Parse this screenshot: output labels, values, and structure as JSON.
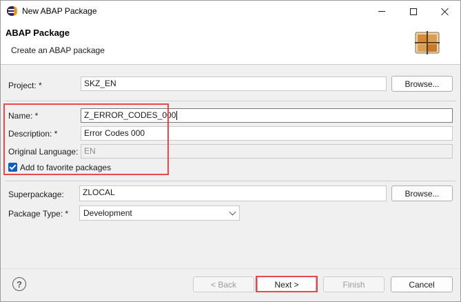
{
  "window": {
    "title": "New ABAP Package"
  },
  "header": {
    "title": "ABAP Package",
    "subtitle": "Create an ABAP package"
  },
  "form": {
    "project": {
      "label": "Project: *",
      "value": "SKZ_EN",
      "browse_label": "Browse..."
    },
    "name": {
      "label": "Name: *",
      "value": "Z_ERROR_CODES_000"
    },
    "description": {
      "label": "Description: *",
      "value": "Error Codes 000"
    },
    "original_language": {
      "label": "Original Language:",
      "value": "EN"
    },
    "favorite": {
      "label": "Add to favorite packages",
      "checked": true
    },
    "superpackage": {
      "label": "Superpackage:",
      "value": "ZLOCAL",
      "browse_label": "Browse..."
    },
    "package_type": {
      "label": "Package Type: *",
      "value": "Development"
    }
  },
  "footer": {
    "help_glyph": "?",
    "back_label": "< Back",
    "next_label": "Next >",
    "finish_label": "Finish",
    "cancel_label": "Cancel"
  },
  "colors": {
    "highlight": "#e8484a",
    "checkbox_accent": "#0a5fc4"
  },
  "icons": [
    "eclipse-app-icon",
    "minimize-icon",
    "maximize-icon",
    "close-icon",
    "package-wizard-icon",
    "chevron-down-icon",
    "help-icon"
  ]
}
